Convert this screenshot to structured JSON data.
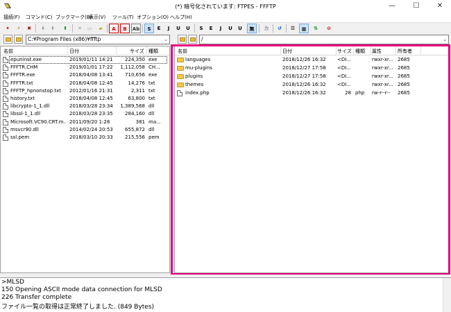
{
  "window": {
    "title": "(*) 暗号化されています: FTPES - FFFTP",
    "minimize": "—",
    "maximize": "☐",
    "close": "✕"
  },
  "menu": [
    "接続(F)",
    "コマンド(C)",
    "ブックマーク(B)",
    "表示(V)",
    "ツール(T)",
    "オプション(O)",
    "ヘルプ(H)"
  ],
  "toolbar": {
    "transfer_buttons": [
      "B",
      "B",
      "Ab"
    ],
    "mode_buttons": [
      "S",
      "E",
      "J",
      "U",
      "U",
      "S",
      "E",
      "J",
      "U",
      "U",
      "無",
      "カ"
    ]
  },
  "local": {
    "path": "C:¥Program Files (x86)¥ffftp",
    "columns": [
      "名前",
      "日付",
      "サイズ",
      "種類"
    ],
    "files": [
      {
        "name": "epuninst.exe",
        "date": "2019/01/11 14:21",
        "size": "224,350",
        "type": "exe"
      },
      {
        "name": "FFFTR.CHM",
        "date": "2019/01/01 17:22",
        "size": "1,112,058",
        "type": "CH..."
      },
      {
        "name": "FFFTR.exe",
        "date": "2018/04/08 13:41",
        "size": "710,656",
        "type": "exe"
      },
      {
        "name": "FFFTR.txt",
        "date": "2018/04/08 12:45",
        "size": "14,276",
        "type": "txt"
      },
      {
        "name": "FFFTP_hpnonstop.txt",
        "date": "2012/01/16 21:31",
        "size": "2,311",
        "type": "txt"
      },
      {
        "name": "history.txt",
        "date": "2018/04/08 12:45",
        "size": "63,800",
        "type": "txt"
      },
      {
        "name": "libcrypto-1_1.dll",
        "date": "2018/03/28 23:34",
        "size": "1,389,568",
        "type": "dll"
      },
      {
        "name": "libssl-1_1.dll",
        "date": "2018/03/28 23:35",
        "size": "284,160",
        "type": "dll"
      },
      {
        "name": "Microsoft.VC90.CRT.m...",
        "date": "2011/09/20 1:28",
        "size": "381",
        "type": "ma..."
      },
      {
        "name": "msvcr90.dll",
        "date": "2014/02/24 20:53",
        "size": "655,872",
        "type": "dll"
      },
      {
        "name": "ssl.pem",
        "date": "2018/03/10 20:33",
        "size": "215,556",
        "type": "pem"
      }
    ]
  },
  "remote": {
    "path": "/",
    "columns": [
      "名前",
      "日付",
      "サイズ",
      "種類",
      "属性",
      "所有者"
    ],
    "files": [
      {
        "name": "languages",
        "date": "2018/12/26 16:32",
        "size": "<DI...",
        "type": "",
        "attr": "rwxr-xr...",
        "owner": "2685",
        "dir": true
      },
      {
        "name": "mu-plugins",
        "date": "2018/12/27 17:58",
        "size": "<DI...",
        "type": "",
        "attr": "rwxr-xr...",
        "owner": "2685",
        "dir": true
      },
      {
        "name": "plugins",
        "date": "2018/12/27 17:58",
        "size": "<DI...",
        "type": "",
        "attr": "rwxr-xr...",
        "owner": "2685",
        "dir": true
      },
      {
        "name": "themes",
        "date": "2018/12/26 16:32",
        "size": "<DI...",
        "type": "",
        "attr": "rwxr-xr...",
        "owner": "2685",
        "dir": true
      },
      {
        "name": "index.php",
        "date": "2018/12/26 16:32",
        "size": "28",
        "type": "php",
        "attr": "rw-r--r--",
        "owner": "2685",
        "dir": false
      }
    ]
  },
  "status_log": [
    ">MLSD",
    "150 Opening ASCII mode data connection for MLSD",
    "226 Transfer complete",
    "ファイル一覧の取得は正常終了しました. (849 Bytes)"
  ],
  "colors": {
    "highlight": "#e6007e",
    "folder": "#f3c94a"
  }
}
